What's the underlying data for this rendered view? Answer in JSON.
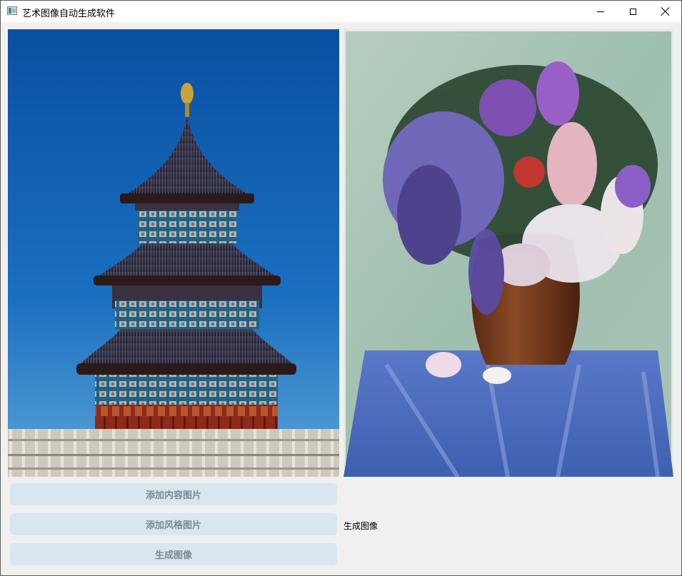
{
  "window": {
    "title": "艺术图像自动生成软件",
    "controls": {
      "minimize": "minimize",
      "maximize": "maximize",
      "close": "close"
    }
  },
  "images": {
    "content": {
      "subject": "temple of heaven pagoda under blue sky"
    },
    "style": {
      "subject": "oil painting of flowers in a brown vase on blue tablecloth"
    }
  },
  "buttons": {
    "add_content": "添加内容图片",
    "add_style": "添加风格图片",
    "generate": "生成图像"
  },
  "result_label": "生成图像",
  "colors": {
    "button_bg": "#d8e6ef",
    "button_text": "#7d8a93",
    "window_bg": "#f0f0f0"
  }
}
